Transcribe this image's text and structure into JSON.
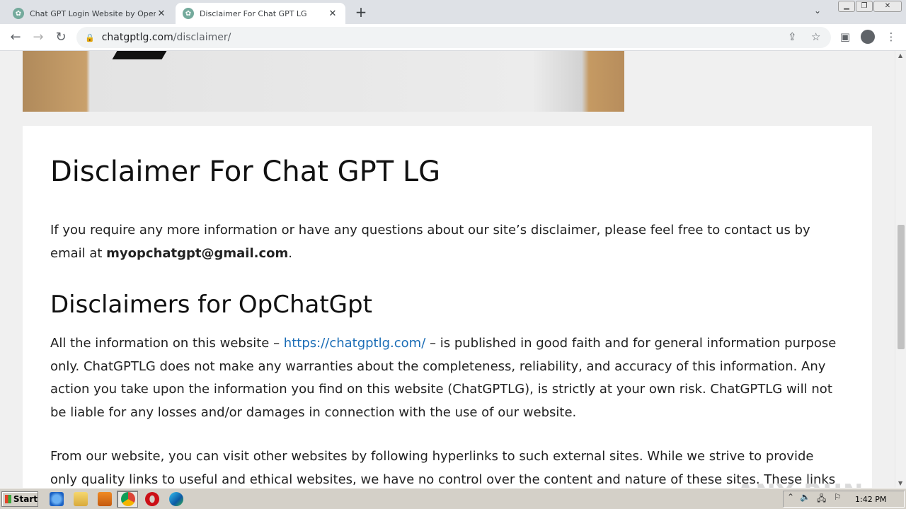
{
  "browser": {
    "tabs": [
      {
        "title": "Chat GPT Login Website by OpenAI,",
        "active": false
      },
      {
        "title": "Disclaimer For Chat GPT LG",
        "active": true
      }
    ],
    "url_host": "chatgptlg.com",
    "url_path": "/disclaimer/",
    "icons": {
      "back": "arrow-left-icon",
      "forward": "arrow-right-icon",
      "reload": "reload-icon",
      "lock": "lock-icon",
      "share": "share-icon",
      "bookmark": "star-icon",
      "sidepanel": "side-panel-icon",
      "profile": "profile-icon",
      "menu": "more-vert-icon"
    }
  },
  "page": {
    "title": "Disclaimer For Chat GPT LG",
    "intro_text": "If you require any more information or have any questions about our site’s disclaimer, please feel free to contact us by email at ",
    "intro_email": "myopchatgpt@gmail.com",
    "intro_end": ".",
    "section_title": "Disclaimers for OpChatGpt",
    "p1_before": "All the information on this website – ",
    "p1_link": "https://chatgptlg.com/",
    "p1_after": " – is published in good faith and for general information purpose only. ChatGPTLG does not make any warranties about the completeness, reliability, and accuracy of this information. Any action you take upon the information you find on this website (ChatGPTLG), is strictly at your own risk. ChatGPTLG will not be liable for any losses and/or damages in connection with the use of our website.",
    "p2": "From our website, you can visit other websites by following hyperlinks to such external sites. While we strive to provide only quality links to useful and ethical websites, we have no control over the content and nature of these sites. These links to"
  },
  "watermark": "ANY RUN",
  "taskbar": {
    "start_label": "Start",
    "clock": "1:42 PM"
  },
  "colors": {
    "link": "#1b6db6",
    "tabstrip": "#dee1e6",
    "taskbar": "#d4d0c8"
  }
}
